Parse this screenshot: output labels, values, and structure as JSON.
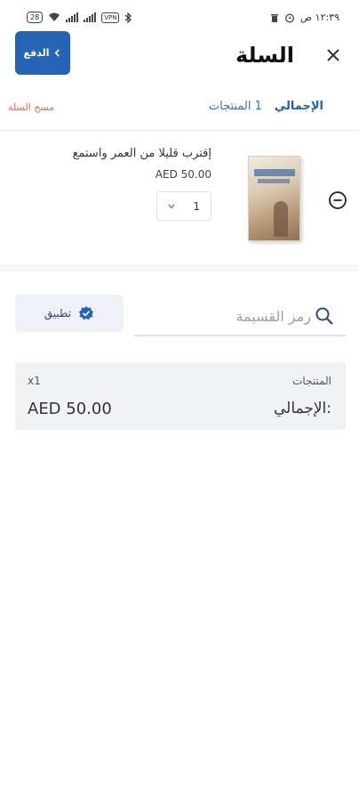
{
  "status_bar": {
    "time": "١٢:٣٩ ص",
    "battery": "28",
    "vpn": "VPN"
  },
  "header": {
    "title": "السلة",
    "pay_label": "الدفع"
  },
  "summary": {
    "total_label": "الإجمالي",
    "products_count": "1 المنتجات",
    "clear_cart": "مسح السلة"
  },
  "cart": {
    "items": [
      {
        "name": "إقترب قليلا من العمر واستمع",
        "price": "AED 50.00",
        "quantity": "1"
      }
    ]
  },
  "coupon": {
    "placeholder": "رمز القسيمة",
    "apply_label": "تطبيق"
  },
  "totals": {
    "products_label": "المنتجات",
    "products_count": "x1",
    "total_label": "الإجمالي:",
    "total_value": "AED 50.00"
  },
  "colors": {
    "primary": "#2563b5",
    "danger": "#e06a5a",
    "panel": "#f1f2f4"
  }
}
